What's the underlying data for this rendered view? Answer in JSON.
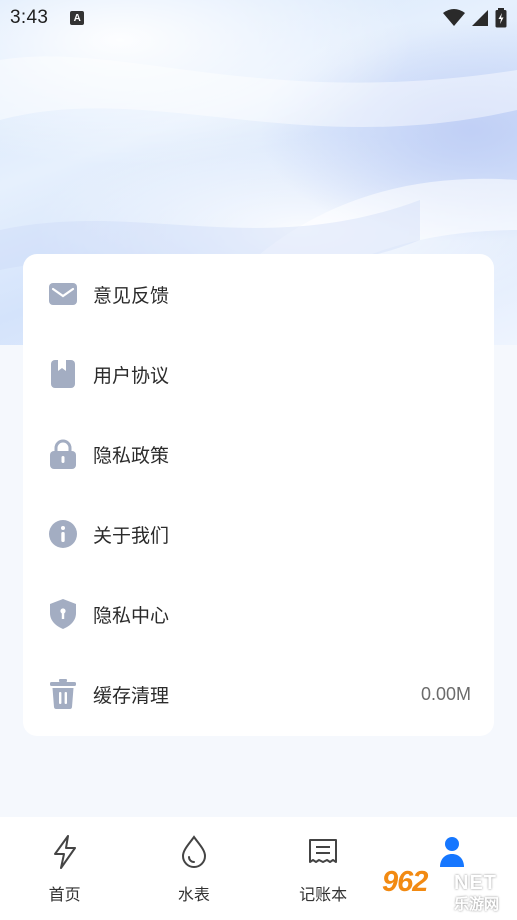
{
  "status_bar": {
    "time": "3:43",
    "notification_letter": "A"
  },
  "menu": {
    "items": [
      {
        "label": "意见反馈",
        "icon": "mail-icon"
      },
      {
        "label": "用户协议",
        "icon": "book-icon"
      },
      {
        "label": "隐私政策",
        "icon": "lock-icon"
      },
      {
        "label": "关于我们",
        "icon": "info-icon"
      },
      {
        "label": "隐私中心",
        "icon": "shield-icon"
      },
      {
        "label": "缓存清理",
        "icon": "trash-icon",
        "value": "0.00M"
      }
    ]
  },
  "tabbar": {
    "tabs": [
      {
        "label": "首页",
        "icon": "lightning-icon",
        "active": false
      },
      {
        "label": "水表",
        "icon": "water-drop-icon",
        "active": false
      },
      {
        "label": "记账本",
        "icon": "ledger-icon",
        "active": false
      },
      {
        "label": "",
        "icon": "user-icon",
        "active": true
      }
    ]
  },
  "watermark": {
    "brand": "962",
    "net": "NET",
    "sub": "乐游网"
  },
  "colors": {
    "icon_gray": "#a3adc2",
    "accent_blue": "#1677ff",
    "watermark_orange": "#f28a12"
  }
}
